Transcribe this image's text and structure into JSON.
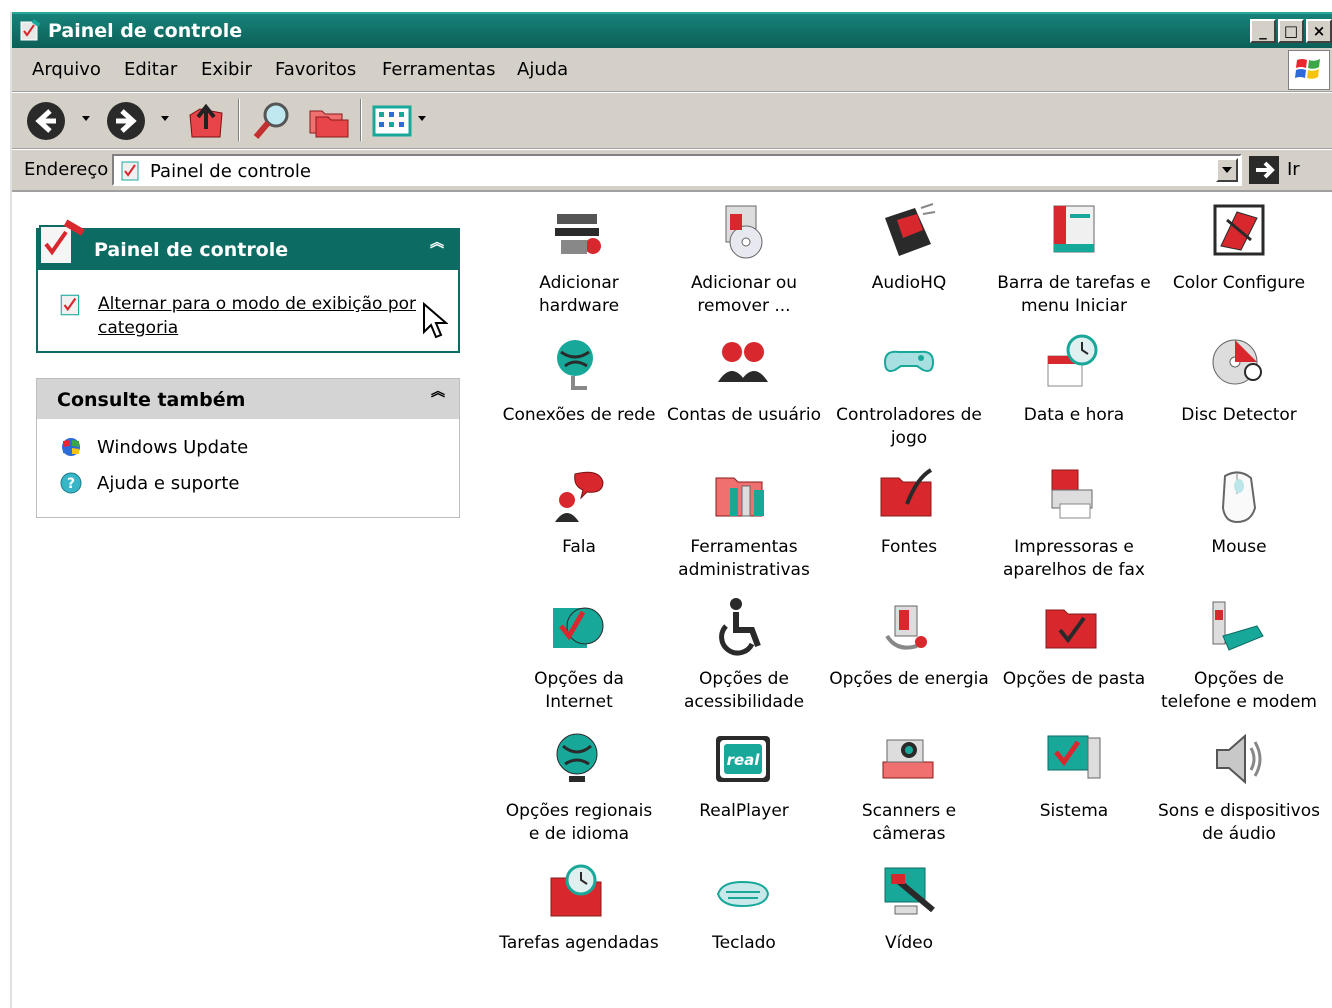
{
  "window": {
    "title": "Painel de controle",
    "buttons": [
      "_",
      "□",
      "×"
    ]
  },
  "menu": {
    "items": [
      "Arquivo",
      "Editar",
      "Exibir",
      "Favoritos",
      "Ferramentas",
      "Ajuda"
    ]
  },
  "toolbar": {
    "buttons": [
      "back-icon",
      "forward-icon",
      "up-folder-icon",
      "search-icon",
      "folders-icon",
      "views-icon"
    ]
  },
  "address": {
    "label": "Endereço",
    "value": "Painel de controle",
    "go_label": "Ir"
  },
  "left": {
    "panel_title": "Painel de controle",
    "switch_link": "Alternar para o modo de exibição por categoria",
    "see_also_title": "Consulte também",
    "see_also": [
      "Windows Update",
      "Ajuda e suporte"
    ]
  },
  "items": [
    {
      "label": "Adicionar hardware",
      "icon": "hardware-icon"
    },
    {
      "label": "Adicionar ou remover ...",
      "icon": "add-remove-programs-icon"
    },
    {
      "label": "AudioHQ",
      "icon": "audiohq-icon"
    },
    {
      "label": "Barra de tarefas e menu Iniciar",
      "icon": "taskbar-icon"
    },
    {
      "label": "Color Configure",
      "icon": "color-configure-icon"
    },
    {
      "label": "Conexões de rede",
      "icon": "network-icon"
    },
    {
      "label": "Contas de usuário",
      "icon": "user-accounts-icon"
    },
    {
      "label": "Controladores de jogo",
      "icon": "game-controller-icon"
    },
    {
      "label": "Data e hora",
      "icon": "date-time-icon"
    },
    {
      "label": "Disc Detector",
      "icon": "disc-detector-icon"
    },
    {
      "label": "Fala",
      "icon": "speech-icon"
    },
    {
      "label": "Ferramentas administrativas",
      "icon": "admin-tools-icon"
    },
    {
      "label": "Fontes",
      "icon": "fonts-icon"
    },
    {
      "label": "Impressoras e aparelhos de fax",
      "icon": "printer-icon"
    },
    {
      "label": "Mouse",
      "icon": "mouse-icon"
    },
    {
      "label": "Opções da Internet",
      "icon": "internet-options-icon"
    },
    {
      "label": "Opções de acessibilidade",
      "icon": "accessibility-icon"
    },
    {
      "label": "Opções de energia",
      "icon": "power-icon"
    },
    {
      "label": "Opções de pasta",
      "icon": "folder-options-icon"
    },
    {
      "label": "Opções de telefone e modem",
      "icon": "phone-modem-icon"
    },
    {
      "label": "Opções regionais e de idioma",
      "icon": "regional-icon"
    },
    {
      "label": "RealPlayer",
      "icon": "realplayer-icon"
    },
    {
      "label": "Scanners e câmeras",
      "icon": "scanner-camera-icon"
    },
    {
      "label": "Sistema",
      "icon": "system-icon"
    },
    {
      "label": "Sons e dispositivos de áudio",
      "icon": "sound-icon"
    },
    {
      "label": "Tarefas agendadas",
      "icon": "scheduled-tasks-icon"
    },
    {
      "label": "Teclado",
      "icon": "keyboard-icon"
    },
    {
      "label": "Vídeo",
      "icon": "video-icon"
    }
  ],
  "colors": {
    "title_bar": "#0c6b63",
    "chrome": "#d4d0c8",
    "accent_red": "#d8282e",
    "accent_teal": "#18a89a"
  }
}
